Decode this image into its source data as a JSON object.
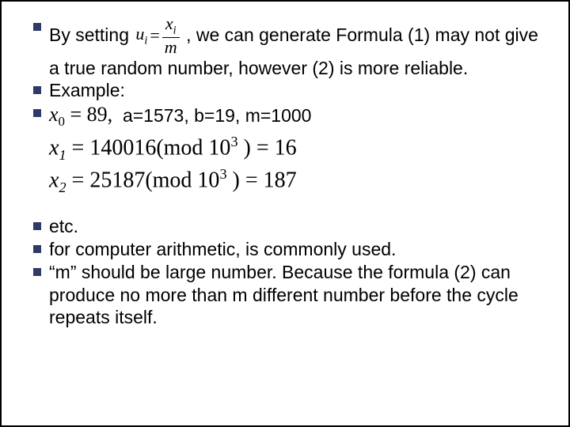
{
  "bullet1": {
    "pre": "By setting ",
    "frac": {
      "lhs_base": "u",
      "lhs_sub": "i",
      "num_base": "x",
      "num_sub": "i",
      "den": "m"
    },
    "post": " , we can generate Formula (1) may not give a true random number, however (2) is more reliable."
  },
  "bullet2": "Example:",
  "bullet3": {
    "x0": {
      "var": "x",
      "sub": "0",
      "eq": " = 89,"
    },
    "params": "  a=1573, b=19, m=1000"
  },
  "eq1": {
    "lhs_var": "x",
    "lhs_sub": "1",
    "body": " = 140016(mod 10",
    "exp": "3",
    "tail": " ) = 16"
  },
  "eq2": {
    "lhs_var": "x",
    "lhs_sub": "2",
    "body": " = 25187(mod 10",
    "exp": "3",
    "tail": " ) = 187"
  },
  "bullet4": "etc.",
  "bullet5": "for computer arithmetic,  is commonly used.",
  "bullet6": "“m” should be large number. Because the formula (2) can produce no more than m different number before the cycle repeats itself."
}
